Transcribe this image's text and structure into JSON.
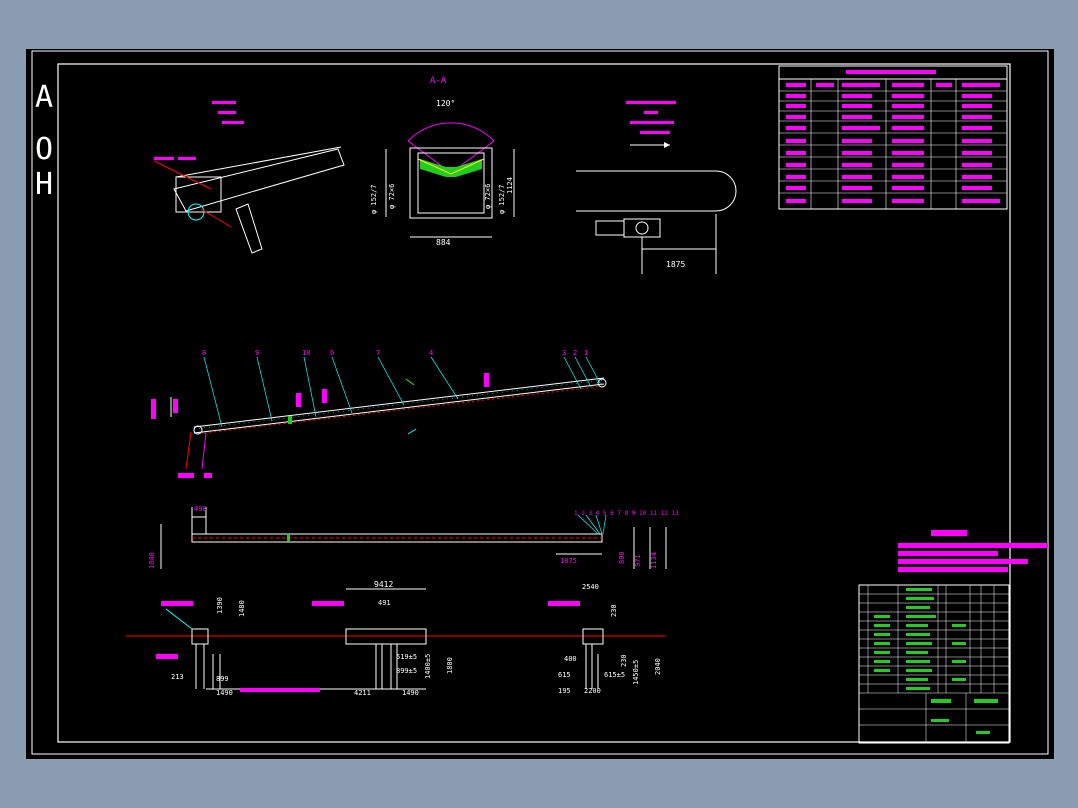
{
  "side_letters": "AOH",
  "section_label": "A-A",
  "angle_label": "120°",
  "dims": {
    "top_left_a": "φ 152/7",
    "top_left_b": "φ 72×6",
    "top_right_a": "φ 72×6",
    "top_right_b": "φ 152/7",
    "top_height": "1124",
    "top_width": "884",
    "drive_len": "1875",
    "mid_top": "498",
    "mid_left": "1040",
    "mid_right_1": "1875",
    "mid_right_2": "800",
    "mid_right_3": "971",
    "mid_right_4": "1134",
    "bot_9412": "9412",
    "bot_491": "491",
    "bot_2540": "2540",
    "bot_1390": "1390",
    "bot_1480": "1480",
    "bot_230": "230",
    "bot_213": "213",
    "bot_899a": "899",
    "bot_1490a": "1490",
    "bot_519": "519±5",
    "bot_899b": "899±5",
    "bot_4211": "4211",
    "bot_1490b": "1490",
    "bot_1400": "1400±5",
    "bot_1800": "1800",
    "bot_400": "400",
    "bot_615": "615",
    "bot_195": "195",
    "bot_2200": "2200",
    "bot_615b": "615±5",
    "bot_1450": "1450±5",
    "bot_230b": "230",
    "bot_2040": "2040"
  },
  "balloons": [
    "8",
    "9",
    "10",
    "6",
    "7",
    "4",
    "3",
    "2",
    "1"
  ],
  "mid_balloons": "1 2 3 4 5 6 7 8 9 10 11 12 13"
}
